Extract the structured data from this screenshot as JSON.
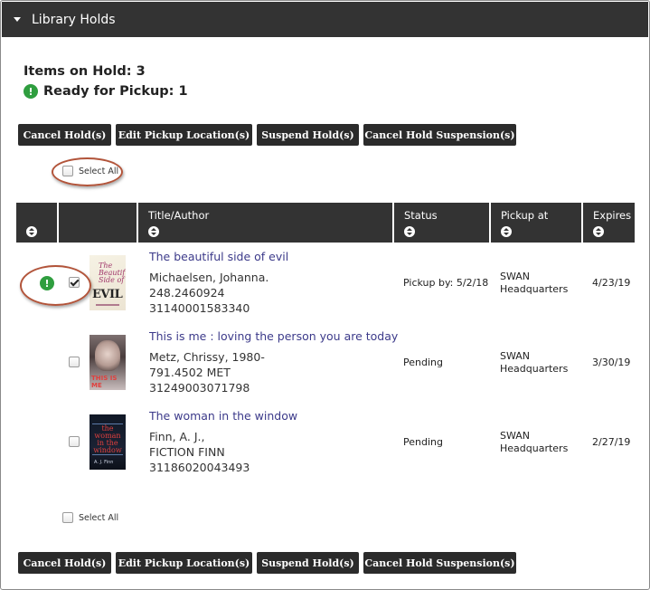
{
  "panel": {
    "title": "Library Holds"
  },
  "summary": {
    "items_on_hold": "Items on Hold: 3",
    "ready_for_pickup": "Ready for Pickup: 1"
  },
  "actions": {
    "cancel_holds": "Cancel Hold(s)",
    "edit_pickup": "Edit Pickup Location(s)",
    "suspend_holds": "Suspend Hold(s)",
    "cancel_suspension": "Cancel Hold Suspension(s)"
  },
  "select_all": "Select All",
  "table": {
    "columns": [
      "",
      "",
      "Title/Author",
      "Status",
      "Pickup at",
      "Expires"
    ],
    "rows": [
      {
        "ready": true,
        "checked": true,
        "cover_icon": "book-cover-beautiful-side-of-evil",
        "title": "The beautiful side of evil",
        "author": "Michaelsen, Johanna.",
        "call_number": "248.2460924",
        "barcode": "31140001583340",
        "status": "Pickup by: 5/2/18",
        "pickup_line1": "SWAN",
        "pickup_line2": "Headquarters",
        "expires": "4/23/19"
      },
      {
        "ready": false,
        "checked": false,
        "cover_icon": "book-cover-this-is-me",
        "title": "This is me : loving the person you are today",
        "author": "Metz, Chrissy, 1980-",
        "call_number": "791.4502 MET",
        "barcode": "31249003071798",
        "status": "Pending",
        "pickup_line1": "SWAN",
        "pickup_line2": "Headquarters",
        "expires": "3/30/19"
      },
      {
        "ready": false,
        "checked": false,
        "cover_icon": "book-cover-woman-in-the-window",
        "title": "The woman in the window",
        "author": "Finn, A. J.,",
        "call_number": "FICTION FINN",
        "barcode": "31186020043493",
        "status": "Pending",
        "pickup_line1": "SWAN",
        "pickup_line2": "Headquarters",
        "expires": "2/27/19"
      }
    ]
  },
  "colors": {
    "header_bg": "#333333",
    "button_bg": "#2b2b2b",
    "link": "#3c3a8a",
    "ready_icon": "#2f9e3f",
    "annotation_ellipse": "#b2543a"
  },
  "cover_text": {
    "cover1_title": "The Beautiful Side of",
    "cover1_word": "EVIL",
    "cover2_title": "THIS IS ME",
    "cover3_title": "the woman in the window",
    "cover3_author": "A. J. Finn"
  }
}
